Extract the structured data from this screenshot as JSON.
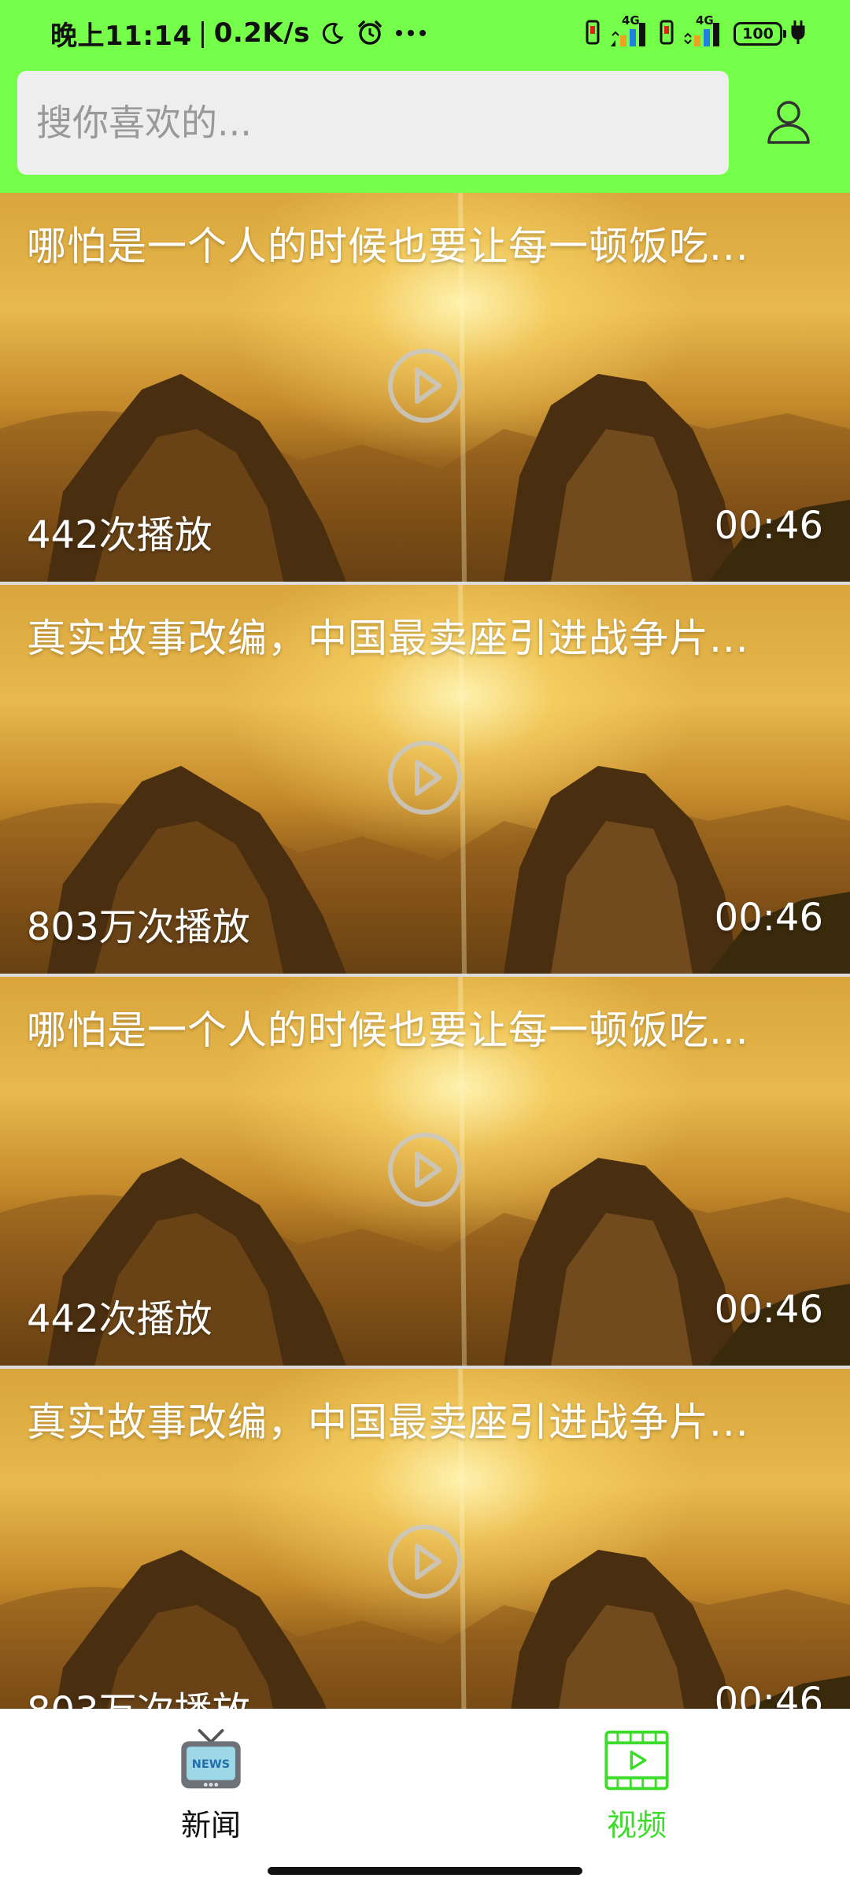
{
  "status_bar": {
    "time": "晚上11:14",
    "net_speed": "0.2K/s",
    "net_type_1": "4G",
    "net_type_2": "4G",
    "battery": "100"
  },
  "search": {
    "placeholder": "搜你喜欢的..."
  },
  "videos": [
    {
      "title": "哪怕是一个人的时候也要让每一顿饭吃...",
      "plays": "442次播放",
      "duration": "00:46"
    },
    {
      "title": "真实故事改编，中国最卖座引进战争片...",
      "plays": "803万次播放",
      "duration": "00:46"
    },
    {
      "title": "哪怕是一个人的时候也要让每一顿饭吃...",
      "plays": "442次播放",
      "duration": "00:46"
    },
    {
      "title": "真实故事改编，中国最卖座引进战争片...",
      "plays": "803万次播放",
      "duration": "00:46"
    }
  ],
  "nav": {
    "news_label": "新闻",
    "news_icon_text": "NEWS",
    "video_label": "视频"
  },
  "colors": {
    "header_green": "#76ff4a",
    "active_tab": "#3ddc2a",
    "search_bg": "#eeeeee"
  },
  "icons": {
    "user": "user-icon",
    "play": "play-circle-icon",
    "news": "tv-news-icon",
    "video": "film-strip-icon"
  }
}
